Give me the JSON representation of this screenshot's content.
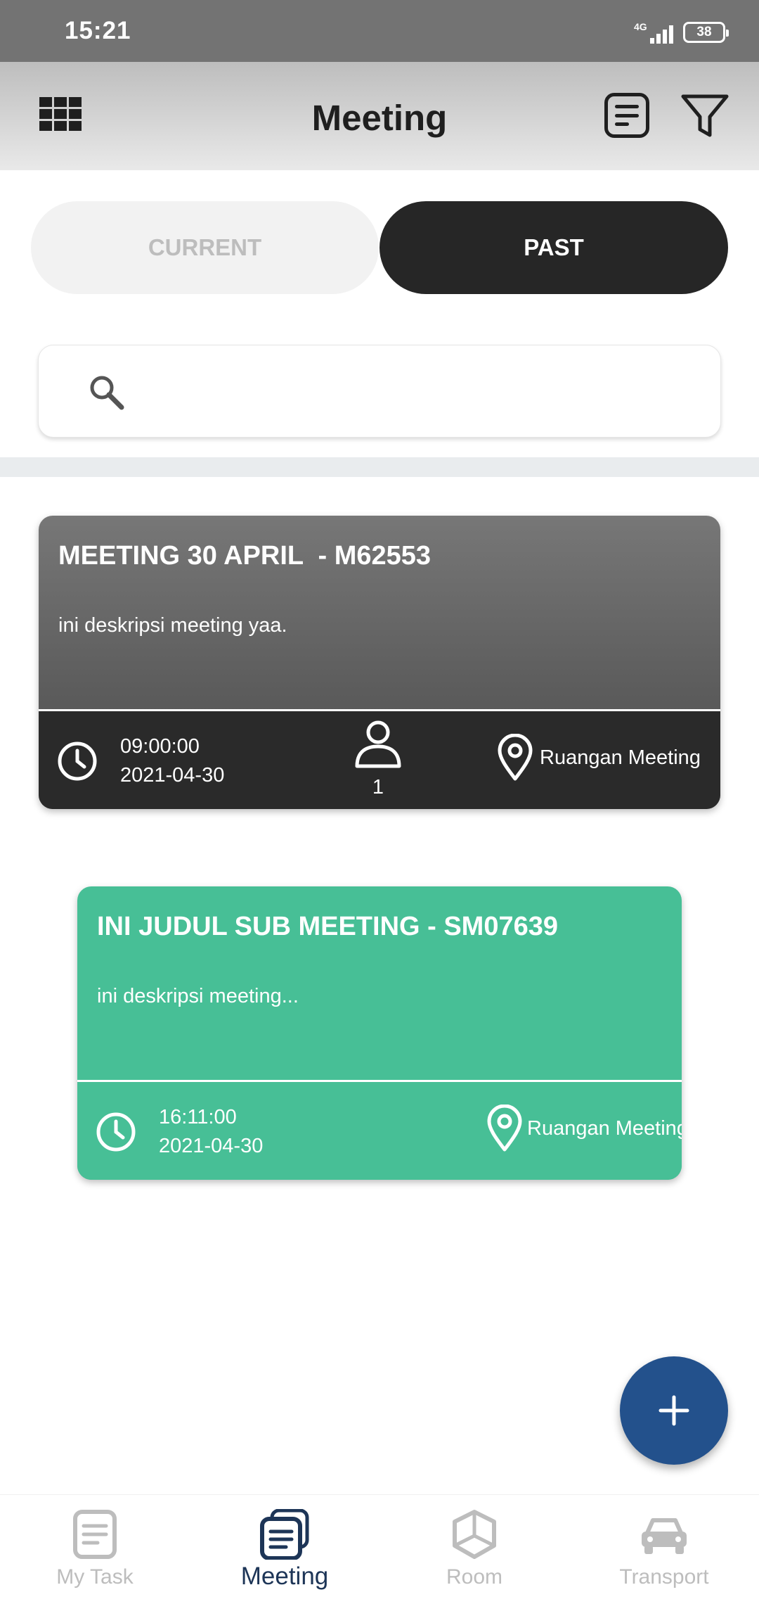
{
  "status_bar": {
    "time": "15:21",
    "network": "4G",
    "battery": "38"
  },
  "app_bar": {
    "title": "Meeting"
  },
  "tabs": {
    "current": "CURRENT",
    "past": "PAST",
    "selected": "past"
  },
  "search": {
    "placeholder": "",
    "value": ""
  },
  "meetings": [
    {
      "title": "MEETING 30 APRIL  - M62553",
      "description": "ini deskripsi meeting yaa.",
      "time": "09:00:00",
      "date": "2021-04-30",
      "participants": "1",
      "location": "Ruangan Meeting"
    },
    {
      "title": "INI JUDUL SUB MEETING - SM07639",
      "description": "ini deskripsi meeting...",
      "time": "16:11:00",
      "date": "2021-04-30",
      "location": "Ruangan Meeting"
    }
  ],
  "fab": {
    "icon": "plus-icon"
  },
  "bottom_nav": {
    "items": [
      {
        "label": "My Task",
        "icon": "clipboard-icon"
      },
      {
        "label": "Meeting",
        "icon": "stacked-list-icon"
      },
      {
        "label": "Room",
        "icon": "cube-icon"
      },
      {
        "label": "Transport",
        "icon": "car-icon"
      }
    ],
    "active": "Meeting"
  },
  "colors": {
    "status_bar": "#737373",
    "card_primary": "#4a4a4a",
    "card_sub": "#47bf96",
    "fab": "#23518c",
    "nav_active": "#1d3557",
    "nav_inactive": "#bdbdbd"
  }
}
